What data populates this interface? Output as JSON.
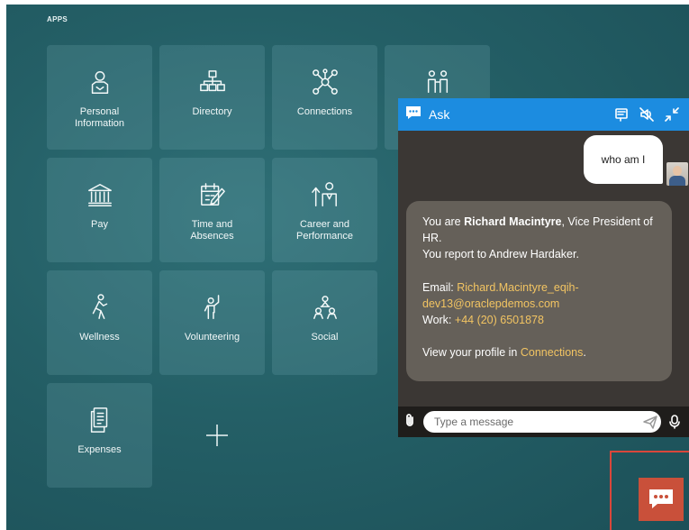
{
  "apps_heading": "APPS",
  "tiles": [
    {
      "label": "Personal Information",
      "icon": "person-id-icon"
    },
    {
      "label": "Directory",
      "icon": "org-chart-icon"
    },
    {
      "label": "Connections",
      "icon": "network-icon"
    },
    {
      "label": "",
      "icon": "team-icon"
    },
    {
      "label": "Pay",
      "icon": "bank-icon"
    },
    {
      "label": "Time and Absences",
      "icon": "calendar-edit-icon"
    },
    {
      "label": "Career and Performance",
      "icon": "career-icon"
    },
    {
      "label": "Wellness",
      "icon": "fitness-icon"
    },
    {
      "label": "Volunteering",
      "icon": "volunteer-icon"
    },
    {
      "label": "Social",
      "icon": "social-icon"
    },
    {
      "label": "Expenses",
      "icon": "expense-doc-icon"
    }
  ],
  "chat": {
    "title": "Ask",
    "user_message": "who am I",
    "reply": {
      "line1_prefix": "You are ",
      "name": "Richard Macintyre",
      "line1_suffix": ", Vice President of HR.",
      "report_line": "You report to Andrew Hardaker.",
      "email_label": "Email: ",
      "email": "Richard.Macintyre_eqih-dev13@oraclepdemos.com",
      "work_label": "Work: ",
      "phone": "+44 (20) 6501878",
      "profile_prefix": "View your profile in ",
      "profile_link": "Connections",
      "profile_suffix": "."
    },
    "input_placeholder": "Type a message"
  },
  "colors": {
    "header_blue": "#1c8ce0",
    "link_gold": "#f2c462",
    "launcher": "#c9503a",
    "highlight_frame": "#d9473b"
  }
}
